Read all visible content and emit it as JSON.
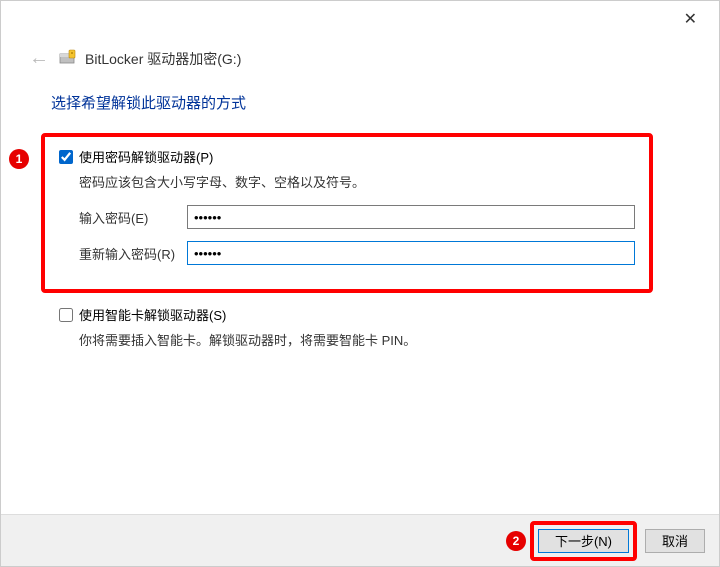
{
  "window": {
    "title": "BitLocker 驱动器加密(G:)"
  },
  "page": {
    "heading": "选择希望解锁此驱动器的方式"
  },
  "option1": {
    "checkbox_label": "使用密码解锁驱动器(P)",
    "hint": "密码应该包含大小写字母、数字、空格以及符号。",
    "field_enter_label": "输入密码(E)",
    "field_enter_value": "••••••",
    "field_reenter_label": "重新输入密码(R)",
    "field_reenter_value": "••••••"
  },
  "option2": {
    "checkbox_label": "使用智能卡解锁驱动器(S)",
    "hint": "你将需要插入智能卡。解锁驱动器时，将需要智能卡 PIN。"
  },
  "footer": {
    "next_label": "下一步(N)",
    "cancel_label": "取消"
  },
  "annotations": {
    "badge1": "1",
    "badge2": "2"
  }
}
